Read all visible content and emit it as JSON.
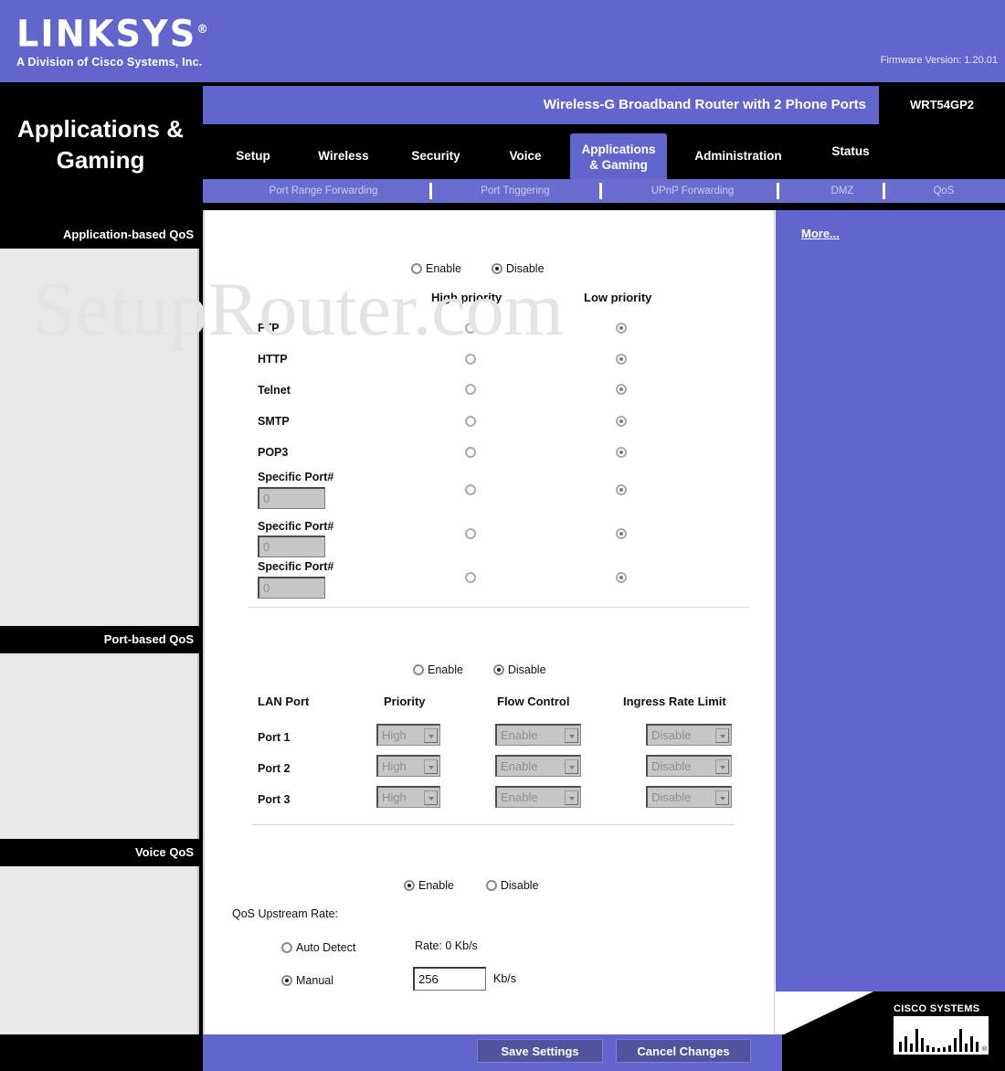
{
  "brand": {
    "logo_text": "LINKSYS",
    "logo_registered": "®",
    "tagline": "A Division of Cisco Systems, Inc.",
    "firmware": "Firmware Version: 1.20.01",
    "cisco_logo_text": "CISCO SYSTEMS"
  },
  "header": {
    "page_title": "Applications & Gaming",
    "product_name": "Wireless-G Broadband Router with 2 Phone Ports",
    "model": "WRT54GP2"
  },
  "nav": {
    "tabs": [
      {
        "label": "Setup",
        "active": false
      },
      {
        "label": "Wireless",
        "active": false
      },
      {
        "label": "Security",
        "active": false
      },
      {
        "label": "Voice",
        "active": false
      },
      {
        "label_line1": "Applications",
        "label_line2": "& Gaming",
        "active": true
      },
      {
        "label": "Administration",
        "active": false
      },
      {
        "label": "Status",
        "active": false
      }
    ],
    "subtabs": [
      "Port Range Forwarding",
      "Port Triggering",
      "UPnP Forwarding",
      "DMZ",
      "QoS"
    ]
  },
  "sidebar": {
    "sections": [
      "Application-based QoS",
      "Port-based QoS",
      "Voice QoS"
    ]
  },
  "help": {
    "more_link": "More..."
  },
  "watermark": "SetupRouter.com",
  "application_qos": {
    "enable_label": "Enable",
    "disable_label": "Disable",
    "selected": "Disable",
    "columns": [
      "High priority",
      "Low priority"
    ],
    "rows": [
      {
        "name": "FTP",
        "type": "label",
        "priority": "Low priority"
      },
      {
        "name": "HTTP",
        "type": "label",
        "priority": "Low priority"
      },
      {
        "name": "Telnet",
        "type": "label",
        "priority": "Low priority"
      },
      {
        "name": "SMTP",
        "type": "label",
        "priority": "Low priority"
      },
      {
        "name": "POP3",
        "type": "label",
        "priority": "Low priority"
      },
      {
        "name": "Specific Port#",
        "type": "input",
        "value": "0",
        "priority": "Low priority"
      },
      {
        "name": "Specific Port#",
        "type": "input",
        "value": "0",
        "priority": "Low priority"
      },
      {
        "name": "Specific Port#",
        "type": "input",
        "value": "0",
        "priority": "Low priority"
      }
    ]
  },
  "port_qos": {
    "enable_label": "Enable",
    "disable_label": "Disable",
    "selected": "Disable",
    "columns": [
      "LAN Port",
      "Priority",
      "Flow Control",
      "Ingress Rate Limit"
    ],
    "rows": [
      {
        "port": "Port 1",
        "priority": "High",
        "flow_control": "Enable",
        "ingress_rate_limit": "Disable"
      },
      {
        "port": "Port 2",
        "priority": "High",
        "flow_control": "Enable",
        "ingress_rate_limit": "Disable"
      },
      {
        "port": "Port 3",
        "priority": "High",
        "flow_control": "Enable",
        "ingress_rate_limit": "Disable"
      }
    ]
  },
  "voice_qos": {
    "enable_label": "Enable",
    "disable_label": "Disable",
    "selected": "Enable",
    "upstream_rate_label": "QoS Upstream Rate:",
    "auto_detect_label": "Auto Detect",
    "manual_label": "Manual",
    "mode_selected": "Manual",
    "auto_rate_text": "Rate: 0 Kb/s",
    "manual_value": "256",
    "manual_unit": "Kb/s"
  },
  "footer": {
    "save_label": "Save Settings",
    "cancel_label": "Cancel Changes"
  },
  "colors": {
    "brand_purple": "#6265cc",
    "subtab_purple": "#6a6dcf",
    "black": "#000000",
    "sidebar_body": "#e9e9e9",
    "button": "#50539e"
  }
}
